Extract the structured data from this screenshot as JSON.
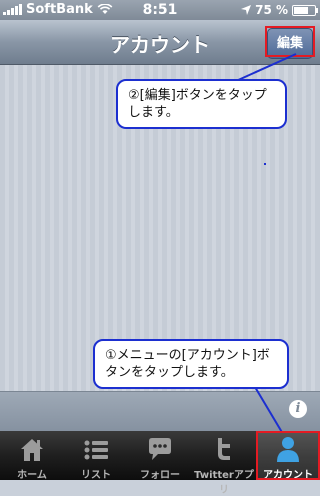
{
  "status_bar": {
    "carrier": "SoftBank",
    "time": "8:51",
    "battery": "75 %",
    "battery_level": 0.75
  },
  "nav": {
    "title": "アカウント",
    "edit_label": "編集"
  },
  "callouts": {
    "edit": "②[編集]ボタンをタップします。",
    "account": "①メニューの[アカウント]ボタンをタップします。"
  },
  "info_label": "i",
  "tabs": [
    {
      "label": "ホーム",
      "icon": "home-icon"
    },
    {
      "label": "リスト",
      "icon": "list-icon"
    },
    {
      "label": "フォロー",
      "icon": "chat-icon"
    },
    {
      "label": "Twitterアプリ",
      "icon": "twitter-icon"
    },
    {
      "label": "アカウント",
      "icon": "person-icon",
      "active": true
    }
  ],
  "colors": {
    "highlight": "#e41b23",
    "callout_border": "#1c2fd0",
    "nav_button": "#4e6a98"
  }
}
